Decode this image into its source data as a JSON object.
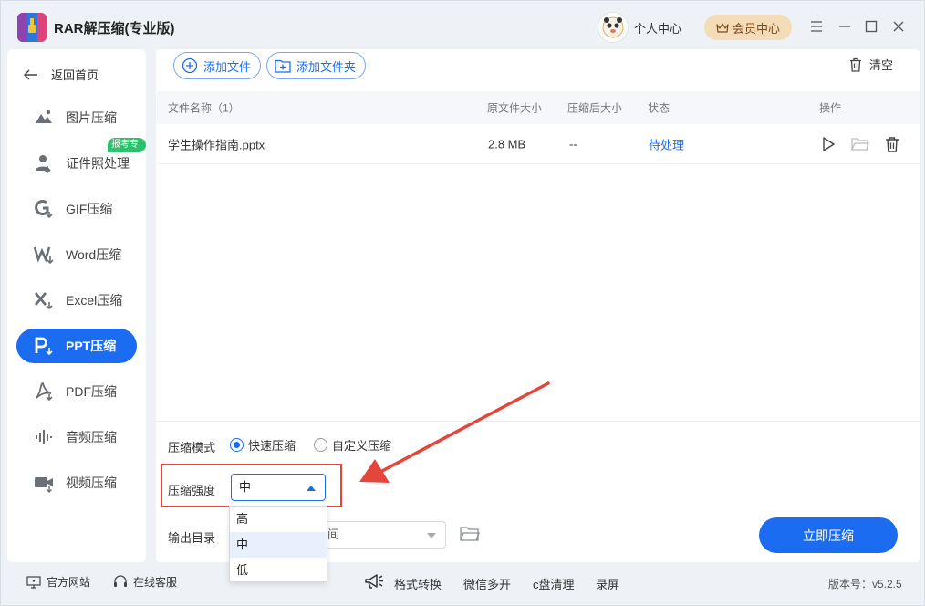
{
  "app": {
    "title": "RAR解压缩(专业版)"
  },
  "header": {
    "user_center": "个人中心",
    "vip_center": "会员中心"
  },
  "sidebar": {
    "back": "返回首页",
    "badge": "报考专用",
    "items": [
      {
        "label": "图片压缩",
        "icon": "image-icon"
      },
      {
        "label": "证件照处理",
        "icon": "id-photo-icon"
      },
      {
        "label": "GIF压缩",
        "icon": "gif-icon"
      },
      {
        "label": "Word压缩",
        "icon": "word-icon"
      },
      {
        "label": "Excel压缩",
        "icon": "excel-icon"
      },
      {
        "label": "PPT压缩",
        "icon": "ppt-icon",
        "active": true
      },
      {
        "label": "PDF压缩",
        "icon": "pdf-icon"
      },
      {
        "label": "音频压缩",
        "icon": "audio-icon"
      },
      {
        "label": "视频压缩",
        "icon": "video-icon"
      }
    ]
  },
  "toolbar": {
    "add_file": "添加文件",
    "add_folder": "添加文件夹",
    "clear": "清空"
  },
  "table": {
    "columns": [
      "文件名称（1）",
      "原文件大小",
      "压缩后大小",
      "状态",
      "操作"
    ],
    "rows": [
      {
        "name": "学生操作指南.pptx",
        "size": "2.8 MB",
        "compressed": "--",
        "status": "待处理"
      }
    ]
  },
  "settings": {
    "mode_label": "压缩模式",
    "mode_options": [
      "快速压缩",
      "自定义压缩"
    ],
    "mode_selected": "快速压缩",
    "strength_label": "压缩强度",
    "strength_value": "中",
    "strength_options": [
      "高",
      "中",
      "低"
    ],
    "output_label": "输出目录",
    "output_value_partial": "间",
    "start_button": "立即压缩"
  },
  "footer": {
    "website": "官方网站",
    "support": "在线客服",
    "format_convert": "格式转换",
    "wechat_multi": "微信多开",
    "disk_clean": "c盘清理",
    "record": "录屏",
    "version": "版本号：v5.2.5"
  },
  "colors": {
    "accent": "#1c6cf2",
    "highlight": "#e5463a",
    "badge": "#2fbf6f",
    "vip": "#f4dcb9"
  }
}
